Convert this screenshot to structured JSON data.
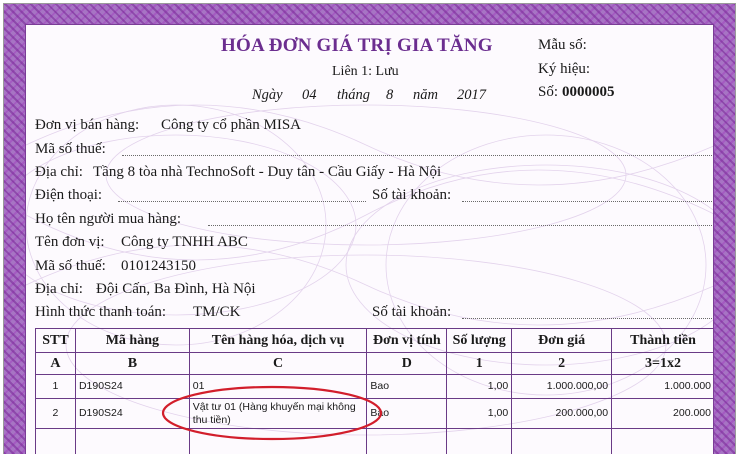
{
  "invoice": {
    "title": "HÓA ĐƠN GIÁ TRỊ GIA TĂNG",
    "copy": "Liên 1: Lưu",
    "date": {
      "day_label": "Ngày",
      "day": "04",
      "month_label": "tháng",
      "month": "8",
      "year_label": "năm",
      "year": "2017"
    },
    "form_no_label": "Mẫu số:",
    "symbol_label": "Ký hiệu:",
    "number_label": "Số:",
    "number": "0000005"
  },
  "seller": {
    "name_label": "Đơn vị bán hàng:",
    "name": "Công ty cổ phần MISA",
    "tax_label": "Mã số thuế:",
    "tax": "",
    "address_label": "Địa chỉ:",
    "address": "Tầng 8 tòa nhà TechnoSoft - Duy tân - Cầu Giấy - Hà Nội",
    "phone_label": "Điện thoại:",
    "phone": "",
    "account_label": "Số tài khoản:",
    "account": ""
  },
  "buyer": {
    "person_label": "Họ tên người mua hàng:",
    "person": "",
    "unit_label": "Tên đơn vị:",
    "unit": "Công ty TNHH ABC",
    "tax_label": "Mã số thuế:",
    "tax": "0101243150",
    "address_label": "Địa chỉ:",
    "address": "Đội Cấn, Ba Đình, Hà Nội",
    "payment_label": "Hình thức thanh toán:",
    "payment": "TM/CK",
    "account_label": "Số tài khoản:",
    "account": ""
  },
  "table": {
    "headers": [
      "STT",
      "Mã hàng",
      "Tên hàng hóa, dịch vụ",
      "Đơn vị tính",
      "Số lượng",
      "Đơn giá",
      "Thành tiền"
    ],
    "letters": [
      "A",
      "B",
      "C",
      "D",
      "1",
      "2",
      "3=1x2"
    ],
    "rows": [
      {
        "stt": "1",
        "code": "D190S24",
        "name": "01",
        "unit": "Bao",
        "qty": "1,00",
        "price": "1.000.000,00",
        "amount": "1.000.000"
      },
      {
        "stt": "2",
        "code": "D190S24",
        "name": "Vật tư 01 (Hàng khuyến mại không thu tiền)",
        "unit": "Bao",
        "qty": "1,00",
        "price": "200.000,00",
        "amount": "200.000"
      }
    ]
  },
  "colors": {
    "title": "#6b2d8f",
    "border": "#a774c4",
    "highlight": "#d21e2b"
  }
}
